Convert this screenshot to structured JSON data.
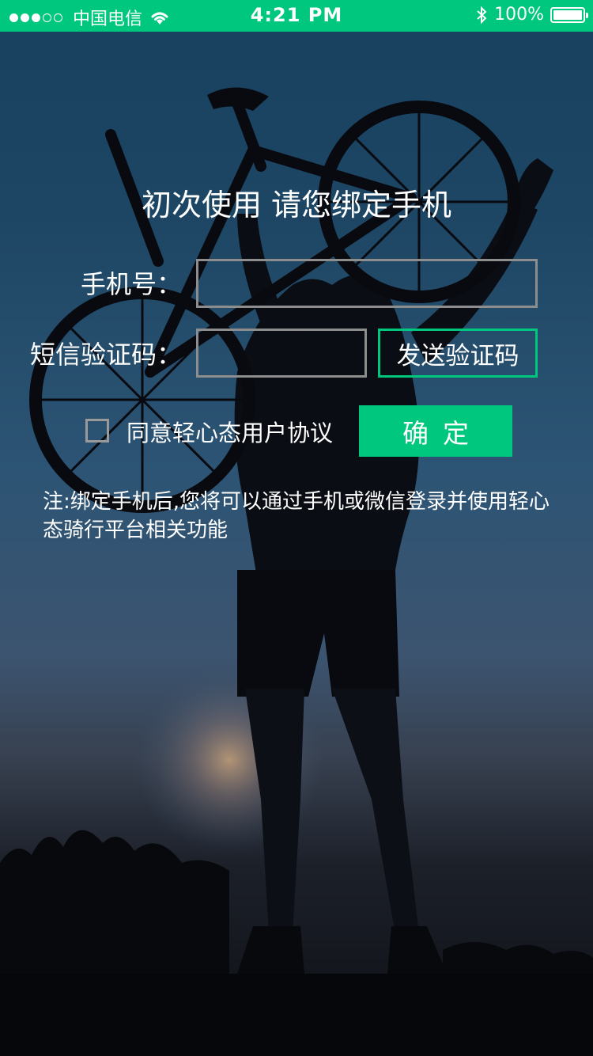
{
  "status_bar": {
    "signal_dots_full": 3,
    "signal_dots_empty": 2,
    "carrier": "中国电信",
    "time": "4:21 PM",
    "battery_percent": "100%",
    "battery_level": 1.0,
    "wifi_icon": "wifi-icon",
    "bluetooth_icon": "bluetooth-icon",
    "bar_color": "#00c77e"
  },
  "form": {
    "title": "初次使用 请您绑定手机",
    "phone_label": "手机号：",
    "phone_value": "",
    "code_label": "短信验证码：",
    "code_value": "",
    "send_code_label": "发送验证码",
    "agree_label": "同意轻心态用户协议",
    "agree_checked": false,
    "confirm_label": "确定",
    "note": "注:绑定手机后,您将可以通过手机或微信登录并使用轻心态骑行平台相关功能",
    "accent_color": "#00c77e"
  }
}
